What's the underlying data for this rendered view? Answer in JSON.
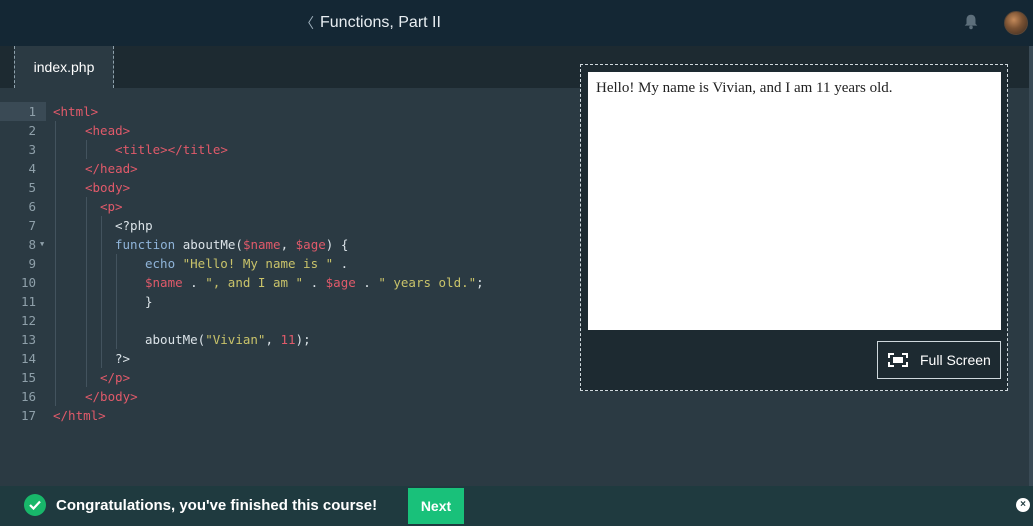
{
  "header": {
    "title": "Functions, Part II",
    "back_icon": "chevron-left-icon",
    "bell_icon": "bell-icon",
    "avatar": "user-avatar"
  },
  "tabs": [
    {
      "label": "index.php"
    }
  ],
  "editor": {
    "lines": [
      {
        "n": "1"
      },
      {
        "n": "2"
      },
      {
        "n": "3"
      },
      {
        "n": "4"
      },
      {
        "n": "5"
      },
      {
        "n": "6"
      },
      {
        "n": "7"
      },
      {
        "n": "8"
      },
      {
        "n": "9"
      },
      {
        "n": "10"
      },
      {
        "n": "11"
      },
      {
        "n": "12"
      },
      {
        "n": "13"
      },
      {
        "n": "14"
      },
      {
        "n": "15"
      },
      {
        "n": "16"
      },
      {
        "n": "17"
      }
    ],
    "tokens": {
      "l1": "<html>",
      "l2": "<head>",
      "l3": "<title></title>",
      "l4": "</head>",
      "l5": "<body>",
      "l6": "<p>",
      "l7": "<?php",
      "l8_kw": "function",
      "l8_name": " aboutMe(",
      "l8_v1": "$name",
      "l8_c": ", ",
      "l8_v2": "$age",
      "l8_end": ") {",
      "l9_kw": "echo",
      "l9_str": " \"Hello! My name is \"",
      "l9_end": " .",
      "l10_v1": "$name",
      "l10_a": " . ",
      "l10_s1": "\", and I am \"",
      "l10_b": " . ",
      "l10_v2": "$age",
      "l10_c": " . ",
      "l10_s2": "\" years old.\"",
      "l10_end": ";",
      "l11": "}",
      "l13_a": "aboutMe(",
      "l13_s": "\"Vivian\"",
      "l13_b": ", ",
      "l13_n": "11",
      "l13_end": ");",
      "l14": "?>",
      "l15": "</p>",
      "l16": "</body>",
      "l17": "</html>"
    }
  },
  "preview": {
    "output": "Hello! My name is Vivian, and I am 11 years old.",
    "fullscreen_label": "Full Screen",
    "fullscreen_icon": "fullscreen-icon"
  },
  "footer": {
    "message": "Congratulations, you've finished this course!",
    "next_label": "Next",
    "close_label": "×",
    "check_icon": "check-circle-icon"
  },
  "colors": {
    "accent": "#19c17a",
    "topbar": "#142734",
    "editor_bg": "#2b3a43",
    "tag": "#e05a6a",
    "string": "#c9c36a"
  }
}
